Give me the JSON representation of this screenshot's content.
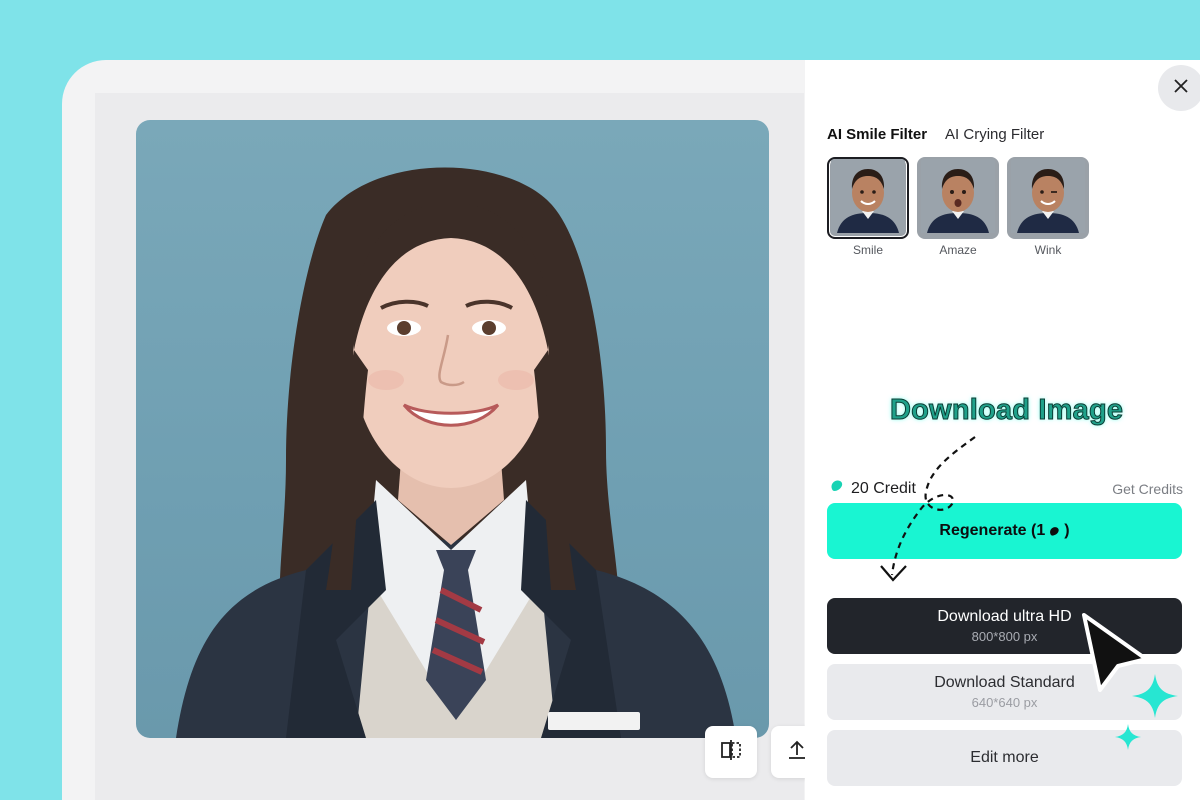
{
  "panel": {
    "tabs": [
      {
        "label": "AI Smile Filter",
        "active": true
      },
      {
        "label": "AI Crying Filter",
        "active": false
      }
    ],
    "thumbnails": [
      {
        "label": "Smile",
        "selected": true
      },
      {
        "label": "Amaze",
        "selected": false
      },
      {
        "label": "Wink",
        "selected": false
      }
    ],
    "credits": {
      "text": "20 Credit",
      "get_label": "Get Credits"
    },
    "regenerate_label": "Regenerate (1",
    "regenerate_suffix": ")",
    "download_ultra": {
      "label": "Download ultra HD",
      "size": "800*800 px"
    },
    "download_standard": {
      "label": "Download Standard",
      "size": "640*640 px"
    },
    "edit_more_label": "Edit more"
  },
  "annotation": {
    "text": "Download Image"
  },
  "icons": {
    "close": "close-icon",
    "compare": "compare-icon",
    "upload": "upload-icon",
    "credit": "credit-bean-icon",
    "cursor": "cursor-arrow-icon",
    "sparkle": "sparkle-icon"
  },
  "colors": {
    "background": "#7fe3e9",
    "accent": "#19f5d2",
    "dark_button": "#22252b",
    "annotation": "#1fa18a"
  }
}
